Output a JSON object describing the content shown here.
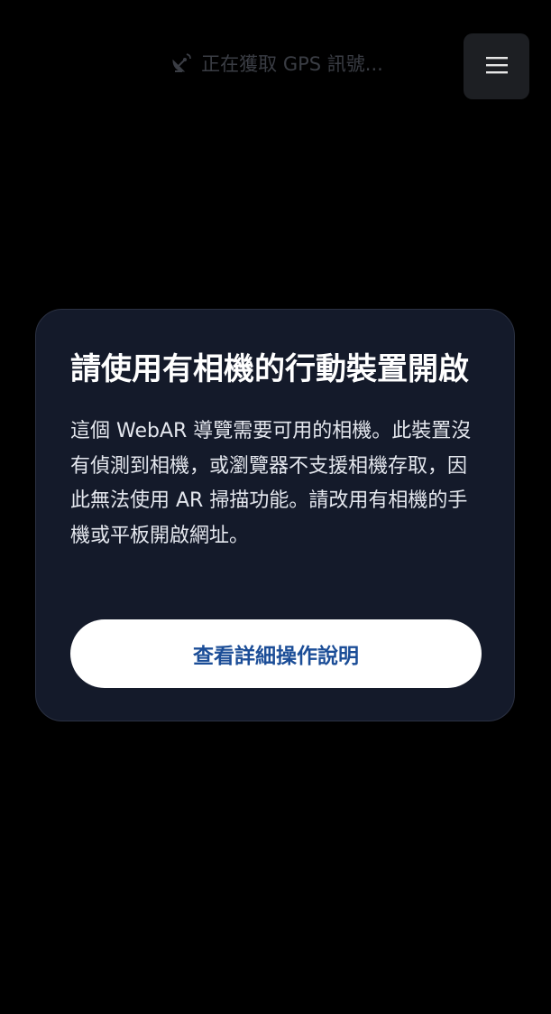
{
  "gps_status": {
    "icon": "satellite-antenna-icon",
    "text": "正在獲取 GPS 訊號..."
  },
  "menu": {
    "icon": "hamburger-menu-icon"
  },
  "camera_card": {
    "title": "請使用有相機的行動裝置開啟",
    "body": "這個 WebAR 導覽需要可用的相機。此裝置沒有偵測到相機，或瀏覽器不支援相機存取，因此無法使用 AR 掃描功能。請改用有相機的手機或平板開啟網址。",
    "button_label": "查看詳細操作說明"
  },
  "colors": {
    "background": "#000000",
    "card_background": "#141a2a",
    "button_background": "#ffffff",
    "button_text": "#1b4d97"
  }
}
